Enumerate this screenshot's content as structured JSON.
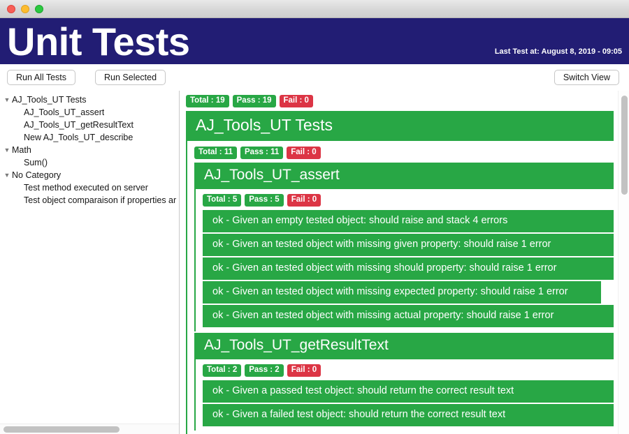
{
  "window": {
    "traffic_lights": [
      "close",
      "minimize",
      "zoom"
    ]
  },
  "header": {
    "title": "Unit Tests",
    "last_test": "Last Test at: August 8, 2019 - 09:05",
    "background_color": "#221d74",
    "title_color": "#ffffff"
  },
  "toolbar": {
    "run_all_label": "Run All Tests",
    "run_selected_label": "Run Selected",
    "switch_view_label": "Switch View"
  },
  "sidebar": {
    "items": [
      {
        "label": "AJ_Tools_UT Tests",
        "type": "group",
        "expanded": true,
        "caret": "▼"
      },
      {
        "label": "AJ_Tools_UT_assert",
        "type": "leaf"
      },
      {
        "label": "AJ_Tools_UT_getResultText",
        "type": "leaf"
      },
      {
        "label": "New AJ_Tools_UT_describe",
        "type": "leaf"
      },
      {
        "label": "Math",
        "type": "group",
        "expanded": true,
        "caret": "▼"
      },
      {
        "label": "Sum()",
        "type": "leaf"
      },
      {
        "label": "No Category",
        "type": "group",
        "expanded": true,
        "caret": "▼"
      },
      {
        "label": "Test method executed on server",
        "type": "leaf"
      },
      {
        "label": "Test object comparaison if properties ar",
        "type": "leaf"
      }
    ]
  },
  "colors": {
    "pass_green": "#28a745",
    "fail_red": "#dc3545",
    "banner_indigo": "#221d74"
  },
  "results": {
    "root_badges": {
      "total": "Total : 19",
      "pass": "Pass : 19",
      "fail": "Fail : 0"
    },
    "root_title": "AJ_Tools_UT Tests",
    "level2_badges": {
      "total": "Total : 11",
      "pass": "Pass : 11",
      "fail": "Fail : 0"
    },
    "level2_title": "AJ_Tools_UT_assert",
    "assert_badges": {
      "total": "Total : 5",
      "pass": "Pass : 5",
      "fail": "Fail : 0"
    },
    "assert_tests": [
      "ok - Given an empty tested object: should raise and stack 4 errors",
      "ok - Given an tested object with missing given property: should raise 1 error",
      "ok - Given an tested object with missing should property: should raise 1 error",
      "ok - Given an tested object with missing expected property: should raise 1 error",
      "ok - Given an tested object with missing actual property: should raise 1 error"
    ],
    "getresulttext_title": "AJ_Tools_UT_getResultText",
    "getresulttext_badges": {
      "total": "Total : 2",
      "pass": "Pass : 2",
      "fail": "Fail : 0"
    },
    "getresulttext_tests": [
      "ok - Given a passed test object: should return the correct result text",
      "ok - Given a failed test object: should return the correct result text"
    ]
  }
}
